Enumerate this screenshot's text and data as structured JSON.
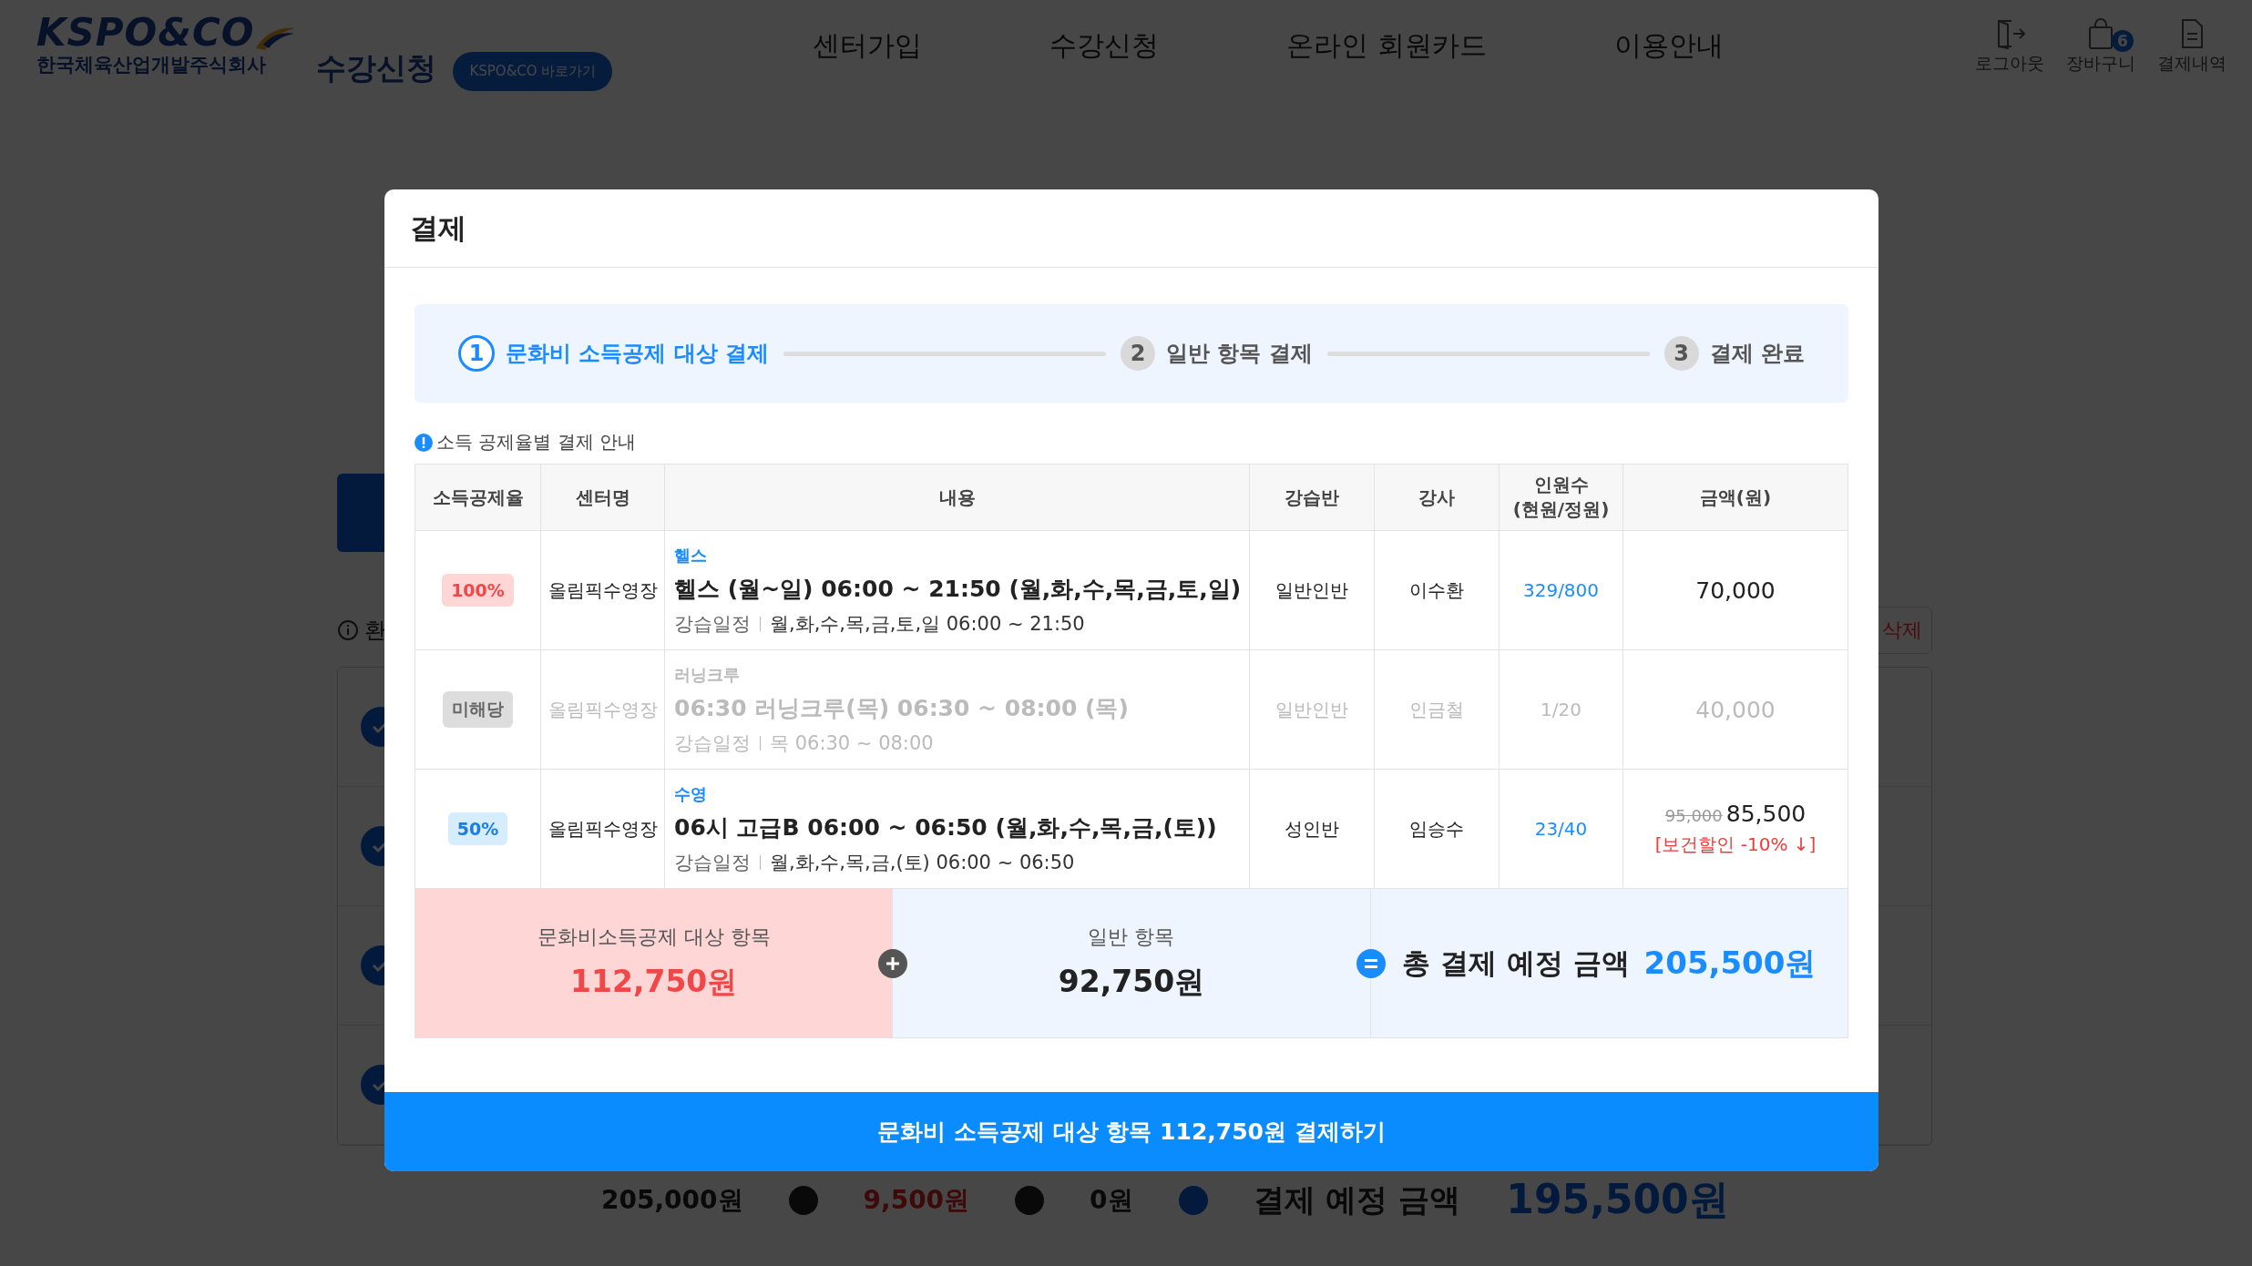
{
  "header": {
    "logo_text": "KSPO&CO",
    "company": "한국체육산업개발주식회사",
    "title": "수강신청",
    "shortcut_button": "KSPO&CO 바로가기",
    "nav": [
      "센터가입",
      "수강신청",
      "온라인 회원카드",
      "이용안내"
    ],
    "actions": [
      {
        "kind": "logout",
        "label": "로그아웃"
      },
      {
        "kind": "cart",
        "label": "장바구니",
        "badge": "6"
      },
      {
        "kind": "receipt",
        "label": "결제내역"
      }
    ]
  },
  "background": {
    "refund_note": "환",
    "delete_button": "삭제",
    "list": [
      {
        "checked": true
      },
      {
        "checked": true
      },
      {
        "checked": true
      },
      {
        "checked": true
      }
    ],
    "summary": {
      "base": "205,000원",
      "discount": "9,500원",
      "extra": "0원",
      "total_label": "결제 예정 금액",
      "total": "195,500원"
    }
  },
  "modal": {
    "title": "결제",
    "steps": [
      {
        "number": "1",
        "label": "문화비 소득공제 대상 결제",
        "selected": true
      },
      {
        "number": "2",
        "label": "일반 항목 결제",
        "selected": false
      },
      {
        "number": "3",
        "label": "결제 완료",
        "selected": false
      }
    ],
    "guide": "소득 공제율별 결제 안내",
    "columns": [
      "소득공제율",
      "센터명",
      "내용",
      "강습반",
      "강사",
      "인원수 (현원/정원)",
      "금액(원)"
    ],
    "rows": [
      {
        "rate": "100%",
        "kind": "full",
        "disabled": false,
        "center": "올림픽수영장",
        "category": "헬스",
        "title": "헬스 (월~일) 06:00 ~ 21:50 (월,화,수,목,금,토,일)",
        "schedule_label": "강습일정",
        "schedule": "월,화,수,목,금,토,일 06:00 ~ 21:50",
        "class": "일반인반",
        "instructor": "이수환",
        "enrollment": "329/800",
        "amount": "70,000"
      },
      {
        "rate": "미해당",
        "kind": "none",
        "disabled": true,
        "center": "올림픽수영장",
        "category": "러닝크루",
        "title": "06:30 러닝크루(목) 06:30 ~ 08:00 (목)",
        "schedule_label": "강습일정",
        "schedule": "목 06:30 ~ 08:00",
        "class": "일반인반",
        "instructor": "인금철",
        "enrollment": "1/20",
        "amount": "40,000"
      },
      {
        "rate": "50%",
        "kind": "half",
        "disabled": false,
        "center": "올림픽수영장",
        "category": "수영",
        "title": "06시 고급B 06:00 ~ 06:50 (월,화,수,목,금,(토))",
        "schedule_label": "강습일정",
        "schedule": "월,화,수,목,금,(토) 06:00 ~ 06:50",
        "class": "성인반",
        "instructor": "임승수",
        "enrollment": "23/40",
        "original_amount": "95,000",
        "amount": "85,500",
        "discount_note": "[보건할인 -10% ↓]"
      }
    ],
    "summary": {
      "deductible_label": "문화비소득공제 대상 항목",
      "deductible_amount": "112,750원",
      "general_label": "일반 항목",
      "general_amount": "92,750원",
      "total_label": "총 결제 예정 금액",
      "total_amount": "205,500원"
    },
    "pay_button": "문화비 소득공제 대상 항목 112,750원 결제하기"
  }
}
